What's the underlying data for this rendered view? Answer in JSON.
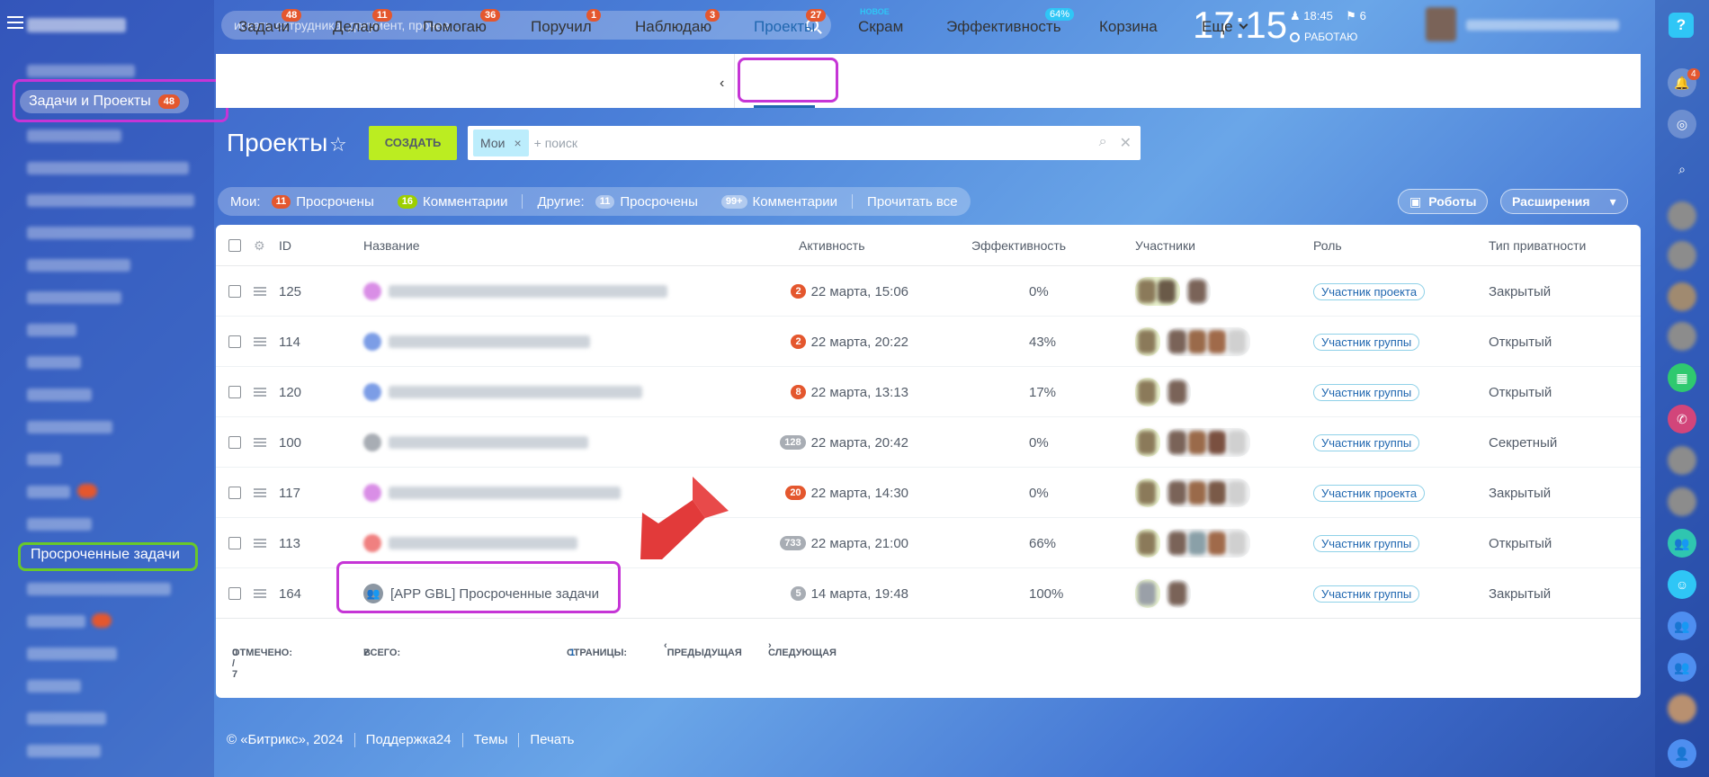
{
  "sidebar": {
    "active_item": "Задачи и Проекты",
    "active_badge": "48",
    "overdue_item": "Просроченные задачи"
  },
  "topbar": {
    "search_placeholder": "искать сотрудника, документ, прочее...",
    "clock": "17:15",
    "alarm_time": "18:45",
    "flag_count": "6",
    "work_status": "РАБОТАЮ"
  },
  "tabs": [
    {
      "label": "Задачи",
      "badge": "48"
    },
    {
      "label": "Делаю",
      "badge": "11"
    },
    {
      "label": "Помогаю",
      "badge": "36"
    },
    {
      "label": "Поручил",
      "badge": "1"
    },
    {
      "label": "Наблюдаю",
      "badge": "3"
    },
    {
      "label": "Проекты",
      "badge": "27"
    },
    {
      "label": "Скрам",
      "tag": "НОВОЕ"
    },
    {
      "label": "Эффективность",
      "tag": "64%"
    },
    {
      "label": "Корзина"
    },
    {
      "label": "Еще"
    }
  ],
  "header": {
    "title": "Проекты",
    "create_label": "СОЗДАТЬ",
    "filter_chip": "Мои",
    "filter_placeholder": "+ поиск"
  },
  "counters": {
    "mine_label": "Мои:",
    "mine_overdue_count": "11",
    "mine_overdue_label": "Просрочены",
    "mine_comments_count": "16",
    "mine_comments_label": "Комментарии",
    "other_label": "Другие:",
    "other_overdue_count": "11",
    "other_overdue_label": "Просрочены",
    "other_comments_count": "99+",
    "other_comments_label": "Комментарии",
    "read_all": "Прочитать все",
    "robots": "Роботы",
    "extensions": "Расширения"
  },
  "columns": {
    "id": "ID",
    "name": "Название",
    "activity": "Активность",
    "efficiency": "Эффективность",
    "members": "Участники",
    "role": "Роль",
    "privacy": "Тип приватности"
  },
  "rows": [
    {
      "id": "125",
      "activity_badge": "2",
      "activity": "22 марта, 15:06",
      "efficiency": "0%",
      "role": "Участник проекта",
      "privacy": "Закрытый",
      "badge_color": "#e4572e",
      "icon_color": "#d98ee6"
    },
    {
      "id": "114",
      "activity_badge": "2",
      "activity": "22 марта, 20:22",
      "efficiency": "43%",
      "role": "Участник группы",
      "privacy": "Открытый",
      "badge_color": "#e4572e",
      "icon_color": "#7c9de6"
    },
    {
      "id": "120",
      "activity_badge": "8",
      "activity": "22 марта, 13:13",
      "efficiency": "17%",
      "role": "Участник группы",
      "privacy": "Открытый",
      "badge_color": "#e4572e",
      "icon_color": "#7c9de6"
    },
    {
      "id": "100",
      "activity_badge": "128",
      "activity": "22 марта, 20:42",
      "efficiency": "0%",
      "role": "Участник группы",
      "privacy": "Секретный",
      "badge_color": "#a8adb4",
      "icon_color": "#a8adb4"
    },
    {
      "id": "117",
      "activity_badge": "20",
      "activity": "22 марта, 14:30",
      "efficiency": "0%",
      "role": "Участник проекта",
      "privacy": "Закрытый",
      "badge_color": "#e4572e",
      "icon_color": "#d98ee6"
    },
    {
      "id": "113",
      "activity_badge": "733",
      "activity": "22 марта, 21:00",
      "efficiency": "66%",
      "role": "Участник группы",
      "privacy": "Открытый",
      "badge_color": "#a8adb4",
      "icon_color": "#f08080"
    },
    {
      "id": "164",
      "name": "[APP GBL] Просроченные задачи",
      "activity_badge": "5",
      "activity": "14 марта, 19:48",
      "efficiency": "100%",
      "role": "Участник группы",
      "privacy": "Закрытый",
      "badge_color": "#a8adb4",
      "icon_color": "#8c97a3"
    }
  ],
  "grid_footer": {
    "selected_label": "ОТМЕЧЕНО:",
    "selected_value": "0 / 7",
    "total_label": "ВСЕГО:",
    "total_value": "7",
    "pages_label": "СТРАНИЦЫ:",
    "pages_value": "1",
    "prev": "ПРЕДЫДУЩАЯ",
    "next": "СЛЕДУЮЩАЯ"
  },
  "footer": {
    "copyright": "© «Битрикс», 2024",
    "support": "Поддержка24",
    "themes": "Темы",
    "print": "Печать"
  },
  "colors": {
    "accent": "#2067b0",
    "create": "#bbed21",
    "badge_red": "#e4572e",
    "highlight_purple": "#c535d6",
    "highlight_green": "#69c82a"
  }
}
